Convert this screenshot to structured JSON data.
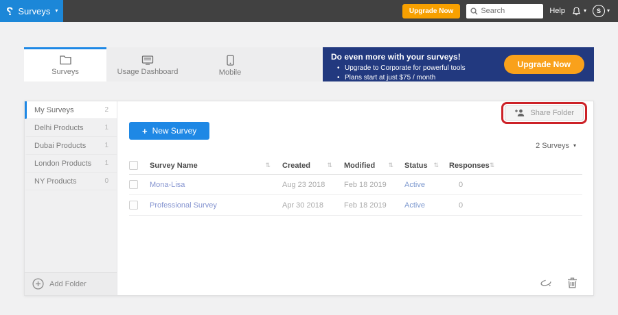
{
  "topbar": {
    "logo_glyph": "?",
    "product_menu": "Surveys",
    "upgrade_button": "Upgrade Now",
    "search_placeholder": "Search",
    "help_label": "Help",
    "avatar_initial": "S",
    "caret": "▾"
  },
  "tabs": [
    {
      "label": "Surveys",
      "icon": "folder-icon",
      "active": true
    },
    {
      "label": "Usage Dashboard",
      "icon": "dashboard-icon",
      "active": false
    },
    {
      "label": "Mobile",
      "icon": "mobile-icon",
      "active": false
    }
  ],
  "banner": {
    "title": "Do even more with your surveys!",
    "bullets": [
      "Upgrade to Corporate for powerful tools",
      "Plans start at just $75 / month"
    ],
    "cta": "Upgrade Now"
  },
  "sidebar": {
    "folders": [
      {
        "name": "My Surveys",
        "count": "2",
        "active": true
      },
      {
        "name": "Delhi Products",
        "count": "1",
        "active": false
      },
      {
        "name": "Dubai Products",
        "count": "1",
        "active": false
      },
      {
        "name": "London Products",
        "count": "1",
        "active": false
      },
      {
        "name": "NY Products",
        "count": "0",
        "active": false
      }
    ],
    "add_folder_label": "Add Folder"
  },
  "main": {
    "new_survey_plus": "+",
    "new_survey_label": "New Survey",
    "share_folder_label": "Share Folder",
    "survey_count_label": "2 Surveys",
    "caret": "▾",
    "sort_glyph": "⇅",
    "table": {
      "headers": [
        "Survey Name",
        "Created",
        "Modified",
        "Status",
        "Responses"
      ],
      "rows": [
        {
          "name": "Mona-Lisa",
          "created": "Aug 23 2018",
          "modified": "Feb 18 2019",
          "status": "Active",
          "responses": "0"
        },
        {
          "name": "Professional Survey",
          "created": "Apr 30 2018",
          "modified": "Feb 18 2019",
          "status": "Active",
          "responses": "0"
        }
      ]
    }
  },
  "colors": {
    "brand_blue": "#1c87d8",
    "action_blue": "#1e88e5",
    "accent_orange": "#f7a000",
    "banner_navy": "#22397f",
    "annotation_red": "#cc2127",
    "link_blue": "#8594d0"
  }
}
